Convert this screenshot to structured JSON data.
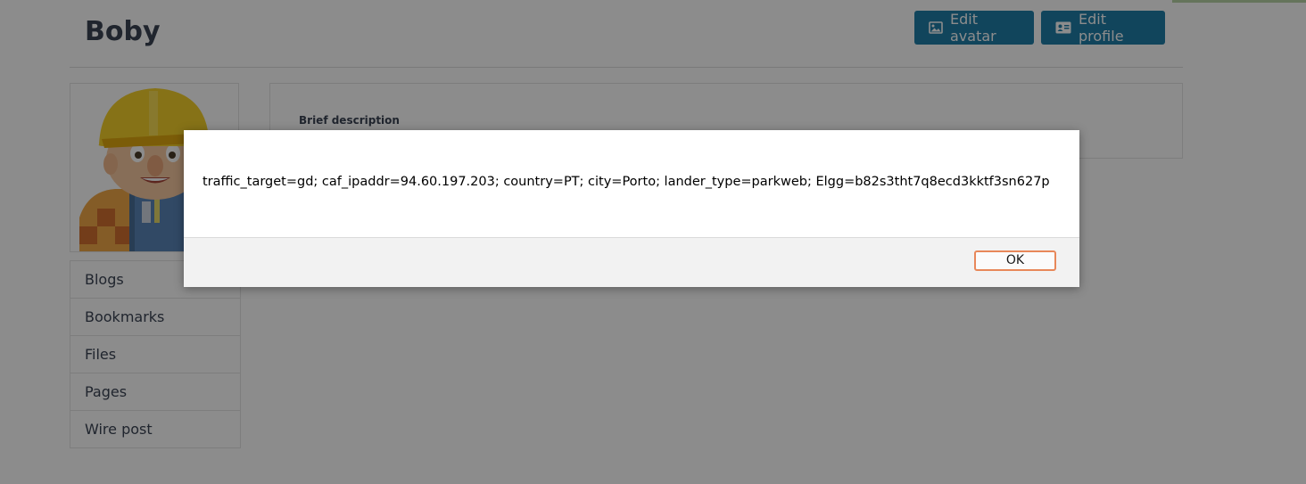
{
  "profile": {
    "name": "Boby",
    "avatar_alt": "Bob the Builder avatar"
  },
  "actions": {
    "edit_avatar_label": "Edit avatar",
    "edit_avatar_icon": "image-icon",
    "edit_profile_label": "Edit profile",
    "edit_profile_icon": "id-card-icon"
  },
  "sidebar": {
    "items": [
      {
        "label": "Blogs"
      },
      {
        "label": "Bookmarks"
      },
      {
        "label": "Files"
      },
      {
        "label": "Pages"
      },
      {
        "label": "Wire post"
      }
    ]
  },
  "details": {
    "brief_description_label": "Brief description"
  },
  "dialog": {
    "message": "traffic_target=gd; caf_ipaddr=94.60.197.203; country=PT; city=Porto; lander_type=parkweb; Elgg=b82s3tht7q8ecd3kktf3sn627p",
    "ok_label": "OK"
  },
  "colors": {
    "primary_button": "#1f7fa8",
    "text_dark": "#3b4454",
    "ok_focus_border": "#e8885a"
  }
}
